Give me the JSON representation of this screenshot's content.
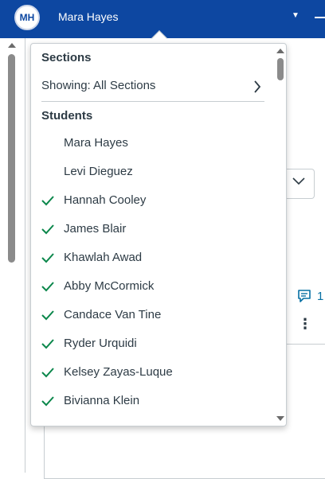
{
  "topbar": {
    "avatar_initials": "MH",
    "user_name": "Mara Hayes",
    "caret_icon": "caret-down-icon",
    "brand_color": "#0d47a1"
  },
  "background": {
    "comment_icon": "comment-icon",
    "comment_count": "1",
    "kebab_icon": "kebab-menu-icon",
    "select_chevron_icon": "chevron-down-icon"
  },
  "menu": {
    "sections_header": "Sections",
    "showing_label": "Showing: All Sections",
    "showing_chevron_icon": "chevron-right-icon",
    "students_header": "Students",
    "check_color": "#0b874b",
    "students": [
      {
        "name": "Mara Hayes",
        "checked": false
      },
      {
        "name": "Levi Dieguez",
        "checked": false
      },
      {
        "name": "Hannah Cooley",
        "checked": true
      },
      {
        "name": "James Blair",
        "checked": true
      },
      {
        "name": "Khawlah Awad",
        "checked": true
      },
      {
        "name": "Abby McCormick",
        "checked": true
      },
      {
        "name": "Candace Van Tine",
        "checked": true
      },
      {
        "name": "Ryder Urquidi",
        "checked": true
      },
      {
        "name": "Kelsey Zayas-Luque",
        "checked": true
      },
      {
        "name": "Bivianna Klein",
        "checked": true
      }
    ]
  }
}
